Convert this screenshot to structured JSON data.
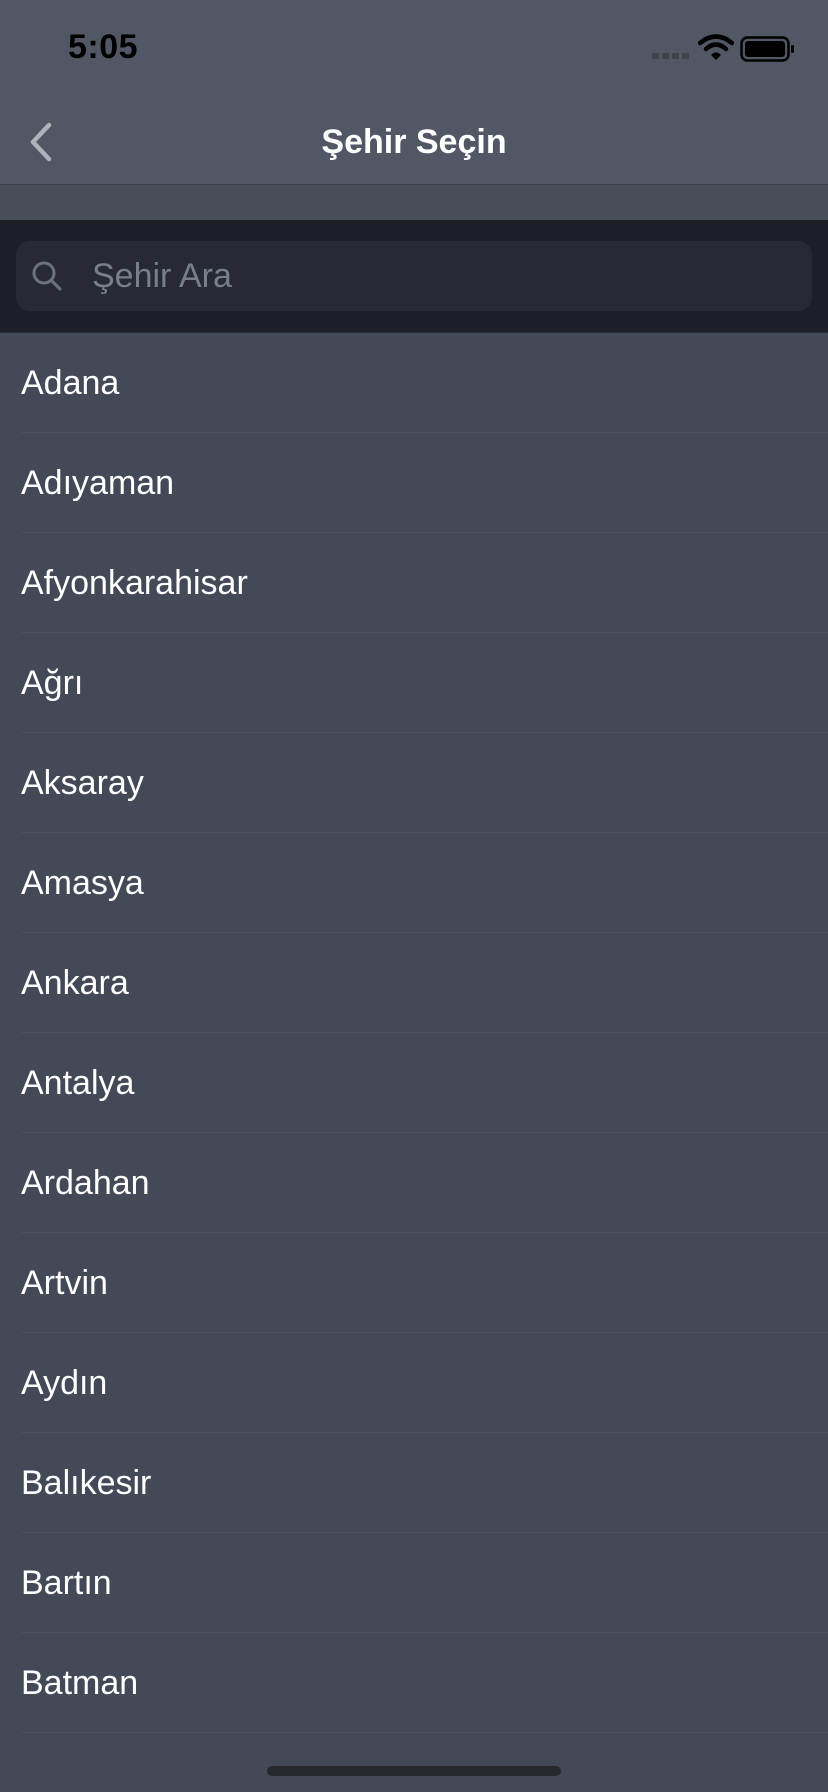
{
  "status_bar": {
    "time": "5:05"
  },
  "nav": {
    "title": "Şehir Seçin",
    "back_icon": "chevron-left-icon"
  },
  "search": {
    "placeholder": "Şehir Ara",
    "value": "",
    "icon": "search-icon"
  },
  "cities": [
    {
      "label": "Adana"
    },
    {
      "label": "Adıyaman"
    },
    {
      "label": "Afyonkarahisar"
    },
    {
      "label": "Ağrı"
    },
    {
      "label": "Aksaray"
    },
    {
      "label": "Amasya"
    },
    {
      "label": "Ankara"
    },
    {
      "label": "Antalya"
    },
    {
      "label": "Ardahan"
    },
    {
      "label": "Artvin"
    },
    {
      "label": "Aydın"
    },
    {
      "label": "Balıkesir"
    },
    {
      "label": "Bartın"
    },
    {
      "label": "Batman"
    }
  ],
  "colors": {
    "nav_background": "#515764",
    "list_background": "#434956",
    "search_bar_background": "#1c1f28",
    "text": "#ffffff"
  }
}
